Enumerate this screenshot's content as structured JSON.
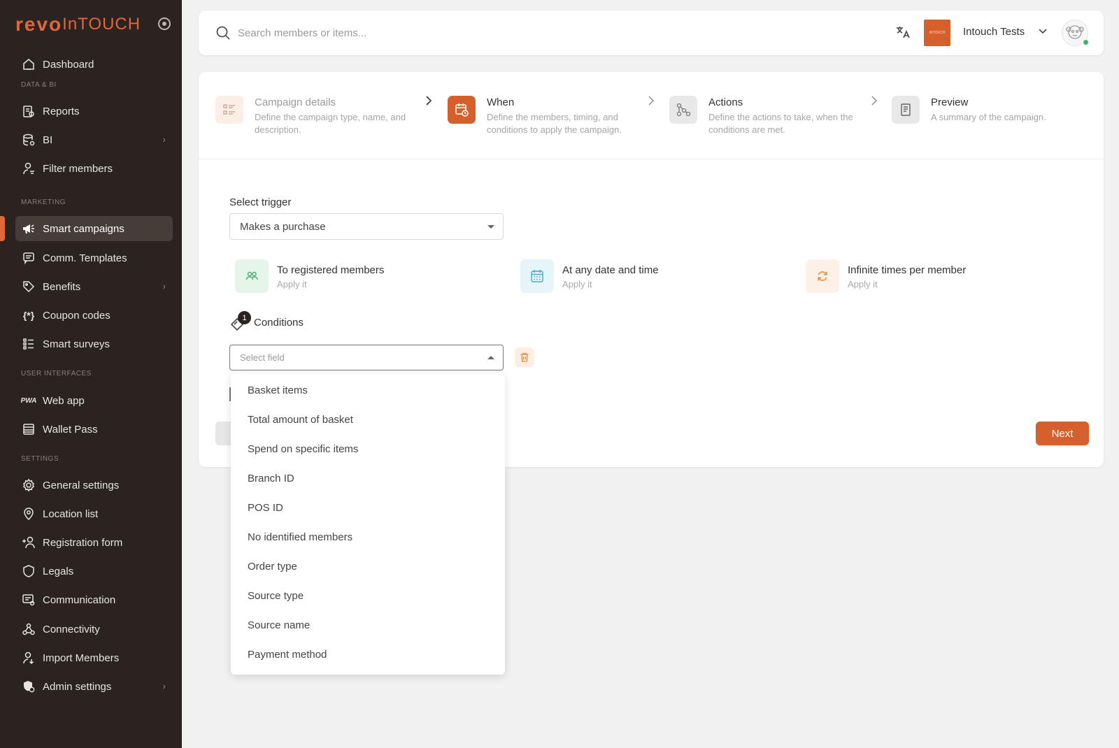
{
  "brand": {
    "logo_part1": "revo",
    "logo_part2": "InTOUCH"
  },
  "sidebar": {
    "sections": {
      "data_bi": "DATA & BI",
      "marketing": "MARKETING",
      "user_interfaces": "USER INTERFACES",
      "settings": "SETTINGS"
    },
    "items": [
      {
        "label": "Dashboard",
        "icon": "home-icon"
      },
      {
        "label": "Reports",
        "icon": "report-icon"
      },
      {
        "label": "BI",
        "icon": "database-icon",
        "has_chevron": true
      },
      {
        "label": "Filter members",
        "icon": "user-filter-icon"
      },
      {
        "label": "Smart campaigns",
        "icon": "megaphone-icon",
        "active": true
      },
      {
        "label": "Comm. Templates",
        "icon": "message-icon"
      },
      {
        "label": "Benefits",
        "icon": "tag-icon",
        "has_chevron": true
      },
      {
        "label": "Coupon codes",
        "icon": "coupon-icon"
      },
      {
        "label": "Smart surveys",
        "icon": "list-icon"
      },
      {
        "label": "Web app",
        "icon": "pwa-icon"
      },
      {
        "label": "Wallet Pass",
        "icon": "wallet-icon"
      },
      {
        "label": "General settings",
        "icon": "gear-icon"
      },
      {
        "label": "Location list",
        "icon": "location-icon"
      },
      {
        "label": "Registration form",
        "icon": "user-plus-icon"
      },
      {
        "label": "Legals",
        "icon": "shield-icon"
      },
      {
        "label": "Communication",
        "icon": "communication-icon"
      },
      {
        "label": "Connectivity",
        "icon": "webhook-icon"
      },
      {
        "label": "Import Members",
        "icon": "import-user-icon"
      },
      {
        "label": "Admin settings",
        "icon": "admin-icon",
        "has_chevron": true
      }
    ],
    "pwa_text": "PWA",
    "accent_color": "#e0673a"
  },
  "topbar": {
    "search_placeholder": "Search members or items...",
    "brand_box_text": "INTOUCH",
    "account_name": "Intouch Tests"
  },
  "steps": [
    {
      "title": "Campaign details",
      "desc": "Define the campaign type, name, and description.",
      "state": "done"
    },
    {
      "title": "When",
      "desc": "Define the members, timing, and conditions to apply the campaign.",
      "state": "active"
    },
    {
      "title": "Actions",
      "desc": "Define the actions to take, when the conditions are met.",
      "state": "pending"
    },
    {
      "title": "Preview",
      "desc": "A summary of the campaign.",
      "state": "pending"
    }
  ],
  "form": {
    "trigger_label": "Select trigger",
    "trigger_value": "Makes a purchase",
    "options": [
      {
        "title": "To registered members",
        "sub": "Apply it"
      },
      {
        "title": "At any date and time",
        "sub": "Apply it"
      },
      {
        "title": "Infinite times per member",
        "sub": "Apply it"
      }
    ],
    "conditions_label": "Conditions",
    "conditions_count": "1",
    "field_placeholder": "Select field",
    "next_label": "Next"
  },
  "dropdown": {
    "items": [
      "Basket items",
      "Total amount of basket",
      "Spend on specific items",
      "Branch ID",
      "POS ID",
      "No identified members",
      "Order type",
      "Source type",
      "Source name",
      "Payment method"
    ]
  }
}
